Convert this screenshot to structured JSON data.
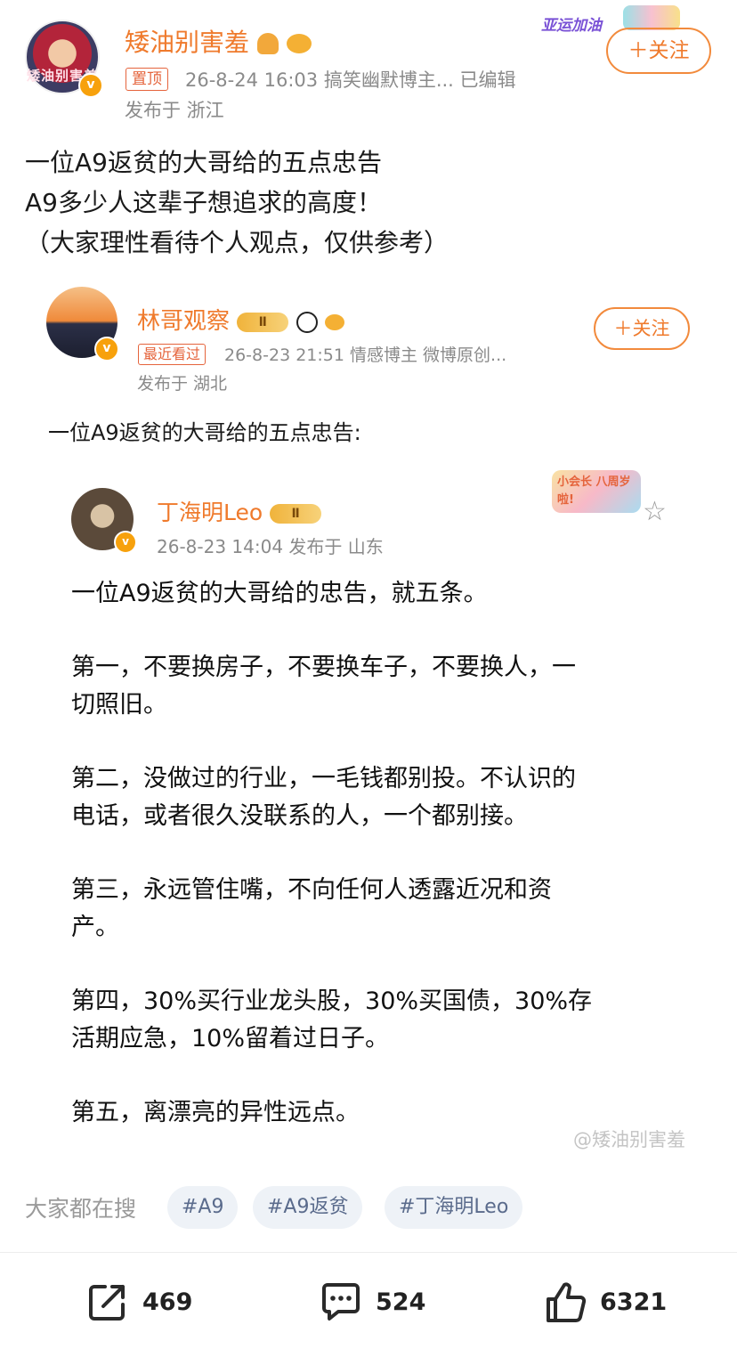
{
  "post": {
    "author": "矮油别害羞",
    "avatar_text": "矮油别害羞",
    "pin_label": "置顶",
    "meta": "26-8-24 16:03   搞笑幽默博主...   已编辑",
    "location": "发布于 浙江",
    "activity_label": "亚运加油",
    "follow_label": "＋关注",
    "text_lines": [
      "一位A9返贫的大哥给的五点忠告",
      "A9多少人这辈子想追求的高度！",
      "（大家理性看待个人观点，仅供参考）"
    ]
  },
  "embed1": {
    "author": "林哥观察",
    "vip_label": "Ⅱ",
    "recent_label": "最近看过",
    "meta": "26-8-23 21:51   情感博主  微博原创...",
    "location": "发布于 湖北",
    "follow_label": "＋关注",
    "text": "一位A9返贫的大哥给的五点忠告:"
  },
  "embed2": {
    "author": "丁海明Leo",
    "vip_label": "Ⅱ",
    "meta": "26-8-23 14:04   发布于 山东",
    "deco_label": "小会长 八周岁啦!",
    "paragraphs": [
      [
        "一位A9返贫的大哥给的忠告，就五条。"
      ],
      [
        "第一，不要换房子，不要换车子，不要换人，一",
        "切照旧。"
      ],
      [
        "第二，没做过的行业，一毛钱都别投。不认识的",
        "电话，或者很久没联系的人，一个都别接。"
      ],
      [
        "第三，永远管住嘴，不向任何人透露近况和资",
        "产。"
      ],
      [
        "第四，30%买行业龙头股，30%买国债，30%存",
        "活期应急，10%留着过日子。"
      ],
      [
        "第五，离漂亮的异性远点。"
      ]
    ],
    "watermark": "@矮油别害羞"
  },
  "search": {
    "label": "大家都在搜",
    "tags": [
      "#A9",
      "#A9返贫",
      "#丁海明Leo"
    ]
  },
  "actions": {
    "repost": "469",
    "comment": "524",
    "like": "6321"
  },
  "colors": {
    "accent_orange": "#ef7a2c",
    "meta_gray": "#8a8a8a",
    "tag_bg": "#eef2f7",
    "tag_text": "#5a6b8c"
  },
  "icons": [
    "crown-icon",
    "fish-icon",
    "panda-icon",
    "star-icon",
    "repost-icon",
    "comment-icon",
    "like-icon",
    "verified-icon"
  ]
}
